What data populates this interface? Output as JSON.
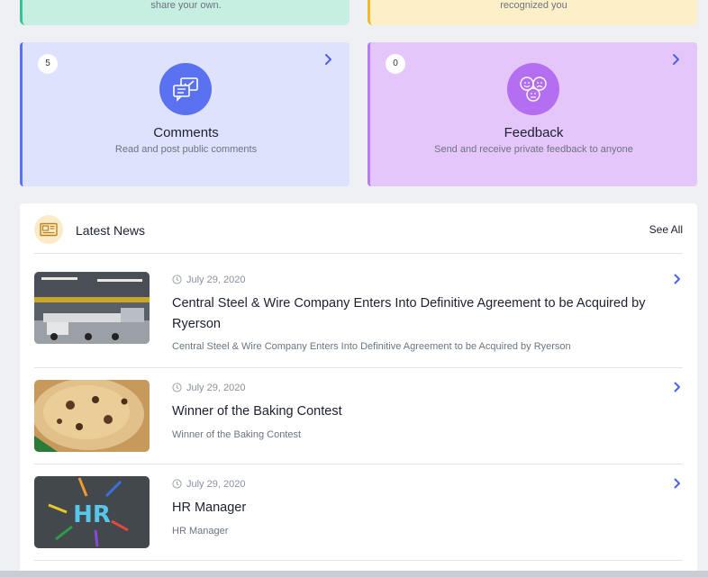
{
  "top_cards": {
    "left_text": "share your own.",
    "right_text": "recognized you"
  },
  "features": [
    {
      "count": "5",
      "title": "Comments",
      "subtitle": "Read and post public comments",
      "icon": "chat-bubbles-icon"
    },
    {
      "count": "0",
      "title": "Feedback",
      "subtitle": "Send and receive private feedback to anyone",
      "icon": "faces-icon"
    }
  ],
  "news": {
    "title": "Latest News",
    "see_all": "See All",
    "items": [
      {
        "date": "July 29, 2020",
        "title": "Central Steel & Wire Company Enters Into Definitive Agreement to be Acquired by Ryerson",
        "subtitle": "Central Steel & Wire Company Enters Into Definitive Agreement to be Acquired by Ryerson",
        "image": "warehouse-photo"
      },
      {
        "date": "July 29, 2020",
        "title": "Winner of the Baking Contest",
        "subtitle": "Winner of the Baking Contest",
        "image": "cookies-photo"
      },
      {
        "date": "July 29, 2020",
        "title": "HR Manager",
        "subtitle": "HR Manager",
        "image": "hr-photo"
      }
    ]
  },
  "thumbnail_text": {
    "hr": "HR"
  },
  "colors": {
    "comments_accent": "#5b73f2",
    "feedback_accent": "#b77df0",
    "chevron": "#4a63e6"
  }
}
